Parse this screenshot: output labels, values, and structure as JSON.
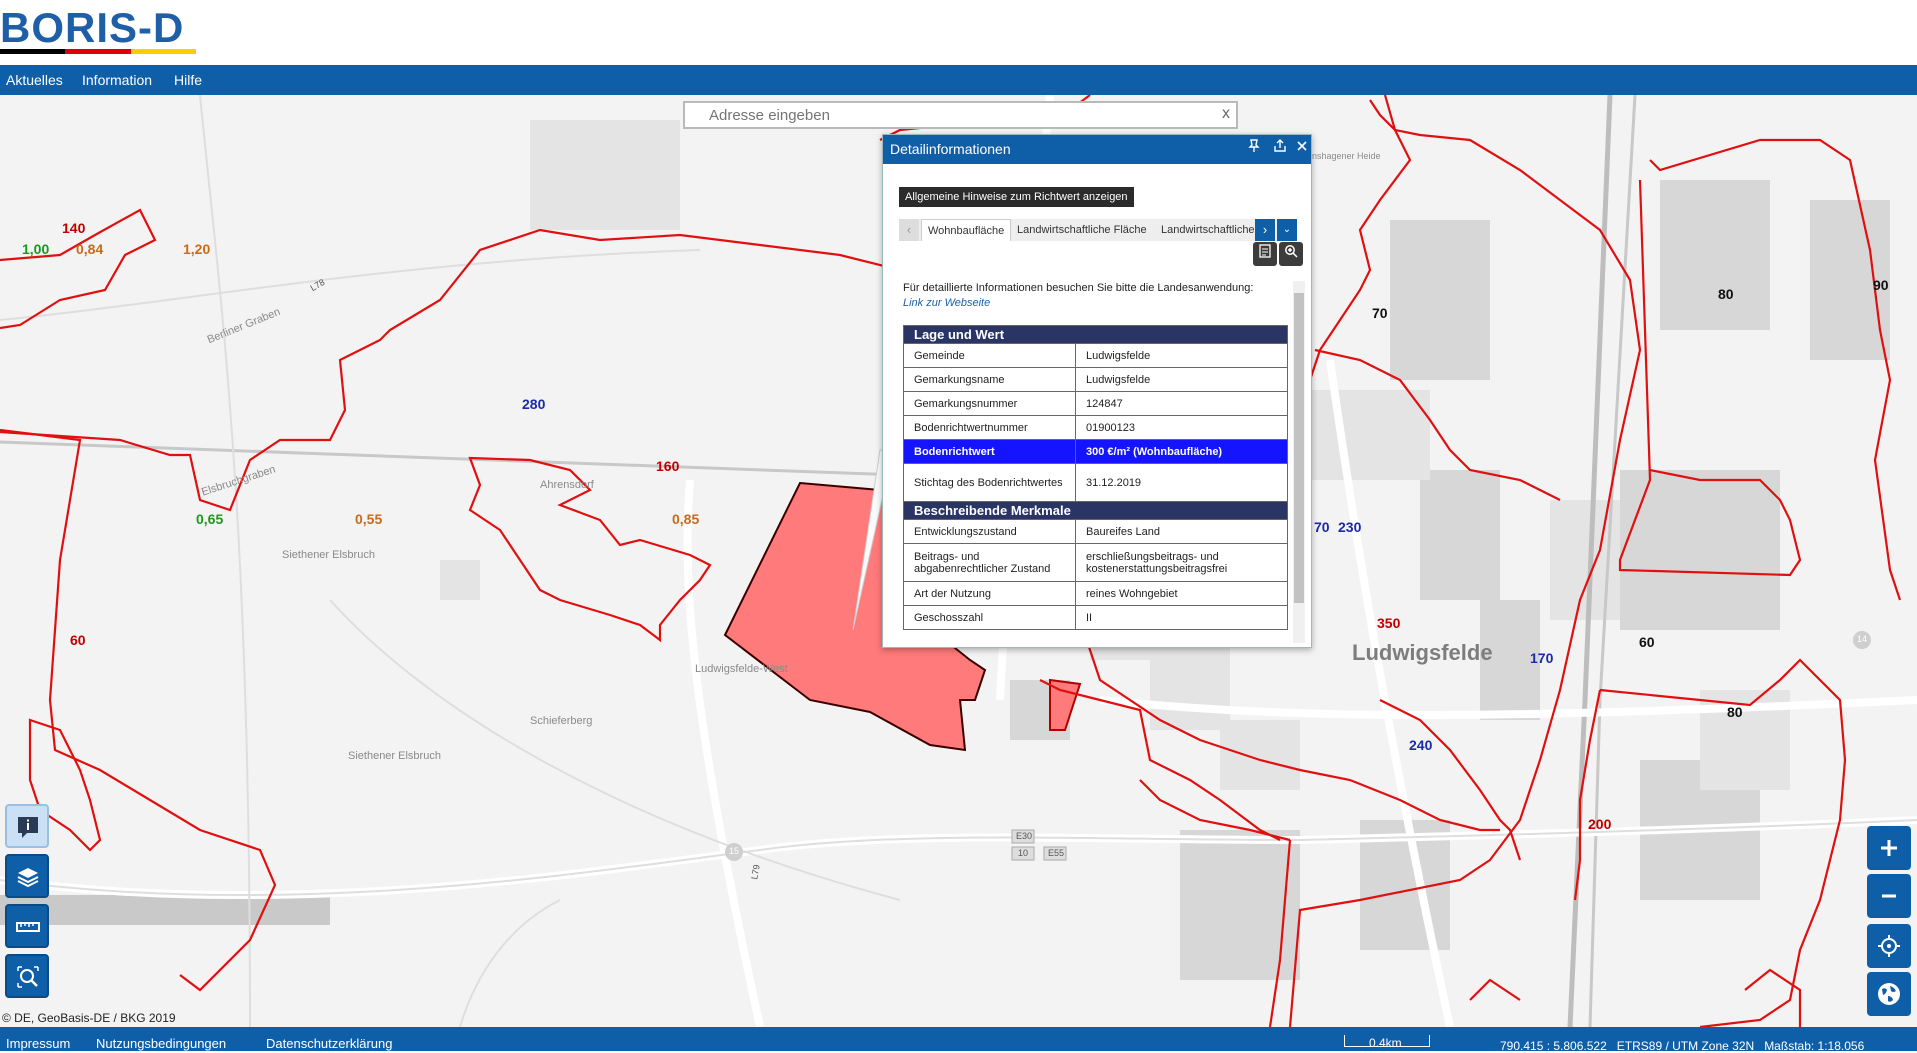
{
  "header": {
    "logo_text": "BORIS-D",
    "logo_colors": [
      "#000000",
      "#dd0000",
      "#ffcc00"
    ],
    "brand_color": "#0f5fa8"
  },
  "nav": {
    "items": [
      "Aktuelles",
      "Information",
      "Hilfe"
    ]
  },
  "search": {
    "placeholder": "Adresse eingeben",
    "clear_label": "x"
  },
  "popup": {
    "title": "Detailinformationen",
    "hint_button": "Allgemeine Hinweise zum Richtwert anzeigen",
    "tabs": [
      "Wohnbaufläche",
      "Landwirtschaftliche Fläche",
      "Landwirtschaftliche F"
    ],
    "info_text": "Für detaillierte Informationen besuchen Sie bitte die Landesanwendung:",
    "info_link": "Link zur Webseite",
    "section1": "Lage und Wert",
    "rows1": [
      {
        "k": "Gemeinde",
        "v": "Ludwigsfelde"
      },
      {
        "k": "Gemarkungsname",
        "v": "Ludwigsfelde"
      },
      {
        "k": "Gemarkungsnummer",
        "v": "124847"
      },
      {
        "k": "Bodenrichtwertnummer",
        "v": "01900123"
      },
      {
        "k": "Bodenrichtwert",
        "v": "300 €/m² (Wohnbaufläche)"
      },
      {
        "k": "Stichtag des Bodenrichtwertes",
        "v": "31.12.2019"
      }
    ],
    "section2": "Beschreibende Merkmale",
    "rows2": [
      {
        "k": "Entwicklungszustand",
        "v": "Baureifes Land"
      },
      {
        "k": "Beitrags- und abgabenrechtlicher Zustand",
        "v": "erschließungsbeitrags- und kostenerstattungsbeitragsfrei"
      },
      {
        "k": "Art der Nutzung",
        "v": "reines Wohngebiet"
      },
      {
        "k": "Geschosszahl",
        "v": "II"
      }
    ],
    "highlight_color": "#1414ff"
  },
  "map": {
    "value_labels": [
      {
        "t": "140",
        "c": "red"
      },
      {
        "t": "1,00",
        "c": "green"
      },
      {
        "t": "0,84",
        "c": "orange"
      },
      {
        "t": "1,20",
        "c": "orange"
      },
      {
        "t": "280",
        "c": "blue"
      },
      {
        "t": "160",
        "c": "red"
      },
      {
        "t": "0,85",
        "c": "orange"
      },
      {
        "t": "0,65",
        "c": "green"
      },
      {
        "t": "0,55",
        "c": "orange"
      },
      {
        "t": "60",
        "c": "red"
      },
      {
        "t": "70",
        "c": "black"
      },
      {
        "t": "80",
        "c": "black"
      },
      {
        "t": "90",
        "c": "black"
      },
      {
        "t": "70",
        "c": "blue"
      },
      {
        "t": "230",
        "c": "blue"
      },
      {
        "t": "170",
        "c": "red"
      },
      {
        "t": "350",
        "c": "red"
      },
      {
        "t": "170",
        "c": "blue"
      },
      {
        "t": "60",
        "c": "black"
      },
      {
        "t": "80",
        "c": "black"
      },
      {
        "t": "240",
        "c": "blue"
      },
      {
        "t": "200",
        "c": "red"
      }
    ],
    "place_labels": [
      "Siethener Elsbruch",
      "Ludwigsfelde-West",
      "Schieferberg",
      "Siethener Elsbruch",
      "Ahrensdorf",
      "Berliner Graben",
      "Elsbruchgraben",
      "Genshagener Heide"
    ],
    "town_label": "Ludwigsfelde",
    "road_labels": [
      "E30",
      "10",
      "E55",
      "15",
      "L79",
      "L78",
      "14"
    ]
  },
  "copyright": "© DE, GeoBasis-DE / BKG 2019",
  "footer": {
    "links": [
      "Impressum",
      "Nutzungsbedingungen",
      "Datenschutzerklärung"
    ],
    "scale": "0.4km",
    "coords": "790.415 : 5.806.522",
    "crs": "ETRS89 / UTM Zone 32N",
    "massstab": "Maßstab: 1:18.056"
  }
}
